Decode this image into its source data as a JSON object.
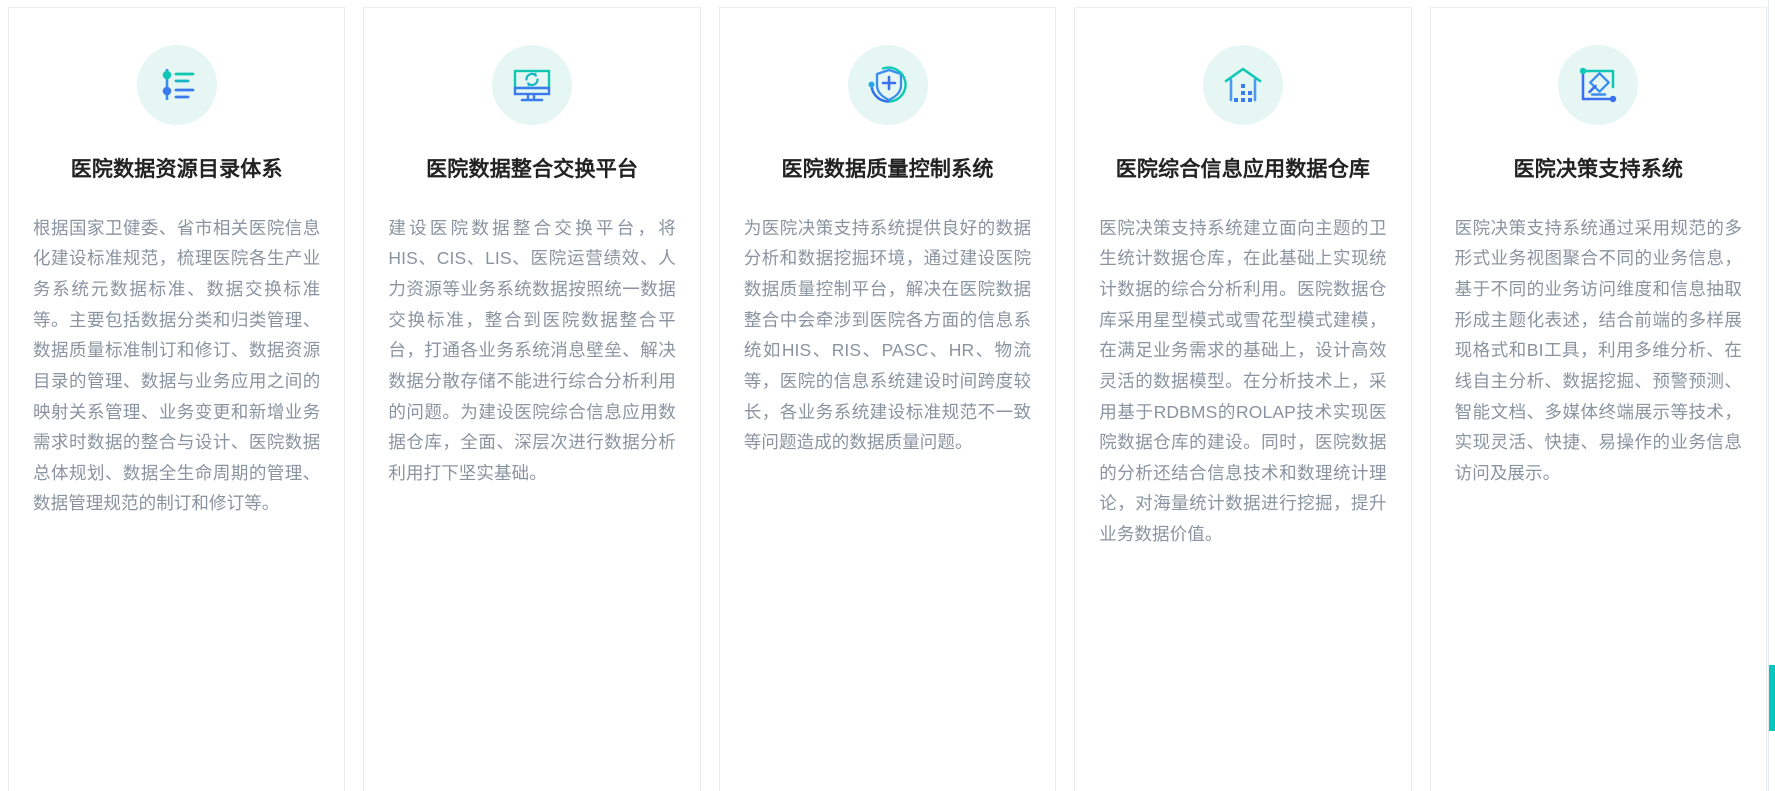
{
  "page": {
    "accent_teal": "#06c6bd",
    "accent_blue": "#3a6ff0",
    "icon_bg": "#e6f6f3",
    "title_color": "#222222",
    "body_color": "#8a94a0",
    "card_border": "#e9ecef"
  },
  "cards": [
    {
      "icon": "sliders-list-icon",
      "title": "医院数据资源目录体系",
      "body": "根据国家卫健委、省市相关医院信息化建设标准规范，梳理医院各生产业务系统元数据标准、数据交换标准等。主要包括数据分类和归类管理、数据质量标准制订和修订、数据资源目录的管理、数据与业务应用之间的映射关系管理、业务变更和新增业务需求时数据的整合与设计、医院数据总体规划、数据全生命周期的管理、数据管理规范的制订和修订等。"
    },
    {
      "icon": "monitor-sync-icon",
      "title": "医院数据整合交换平台",
      "body": "建设医院数据整合交换平台，将HIS、CIS、LIS、医院运营绩效、人力资源等业务系统数据按照统一数据交换标准，整合到医院数据整合平台，打通各业务系统消息壁垒、解决数据分散存储不能进行综合分析利用的问题。为建设医院综合信息应用数据仓库，全面、深层次进行数据分析利用打下坚实基础。"
    },
    {
      "icon": "shield-plus-icon",
      "title": "医院数据质量控制系统",
      "body": "为医院决策支持系统提供良好的数据分析和数据挖掘环境，通过建设医院数据质量控制平台，解决在医院数据整合中会牵涉到医院各方面的信息系统如HIS、RIS、PASC、HR、物流等，医院的信息系统建设时间跨度较长，各业务系统建设标准规范不一致等问题造成的数据质量问题。"
    },
    {
      "icon": "warehouse-icon",
      "title": "医院综合信息应用数据仓库",
      "body": "医院决策支持系统建立面向主题的卫生统计数据仓库，在此基础上实现统计数据的综合分析利用。医院数据仓库采用星型模式或雪花型模式建模，在满足业务需求的基础上，设计高效灵活的数据模型。在分析技术上，采用基于RDBMS的ROLAP技术实现医院数据仓库的建设。同时，医院数据的分析还结合信息技术和数理统计理论，对海量统计数据进行挖掘，提升业务数据价值。"
    },
    {
      "icon": "frame-stamp-icon",
      "title": "医院决策支持系统",
      "body": "医院决策支持系统通过采用规范的多形式业务视图聚合不同的业务信息，基于不同的业务访问维度和信息抽取形成主题化表述，结合前端的多样展现格式和BI工具，利用多维分析、在线自主分析、数据挖掘、预警预测、智能文档、多媒体终端展示等技术，实现灵活、快捷、易操作的业务信息访问及展示。"
    }
  ]
}
